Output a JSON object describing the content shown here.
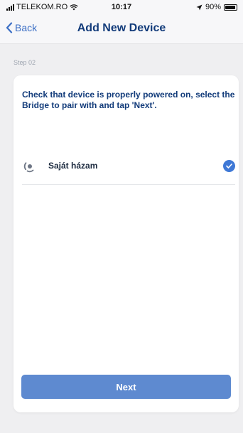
{
  "status_bar": {
    "carrier": "TELEKOM.RO",
    "time": "10:17",
    "battery": "90%",
    "battery_level": 0.9,
    "icons": [
      "signal-icon",
      "wifi-icon",
      "location-arrow-icon",
      "battery-icon"
    ]
  },
  "nav": {
    "back_label": "Back",
    "title": "Add New Device",
    "accent_color": "#3c6fc5",
    "title_color": "#123b7a"
  },
  "step": {
    "label": "Step 02"
  },
  "card": {
    "instruction": "Check that device is properly powered on, select the Bridge to pair with and tap 'Next'.",
    "bridges": [
      {
        "name": "Saját házam",
        "icon": "bridge-icon",
        "selected": true
      }
    ],
    "next_label": "Next",
    "button_color": "#5e8ad0",
    "check_color": "#3e78d6"
  }
}
